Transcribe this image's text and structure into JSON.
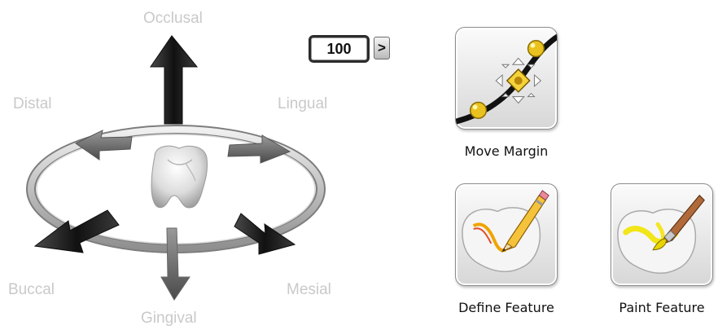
{
  "orientation": {
    "occlusal": "Occlusal",
    "distal": "Distal",
    "lingual": "Lingual",
    "buccal": "Buccal",
    "mesial": "Mesial",
    "gingival": "Gingival"
  },
  "step_control": {
    "value": "100",
    "button_label": ">"
  },
  "tools": {
    "move_margin": "Move Margin",
    "define_feature": "Define Feature",
    "paint_feature": "Paint Feature"
  },
  "icons": {
    "move_margin": "margin-curve-move-icon",
    "define_feature": "tooth-pencil-icon",
    "paint_feature": "tooth-brush-icon"
  },
  "colors": {
    "label_gray": "#c9c9c9",
    "arrow_dark": "#1f1f1f",
    "highlight_yellow": "#f2e300"
  }
}
